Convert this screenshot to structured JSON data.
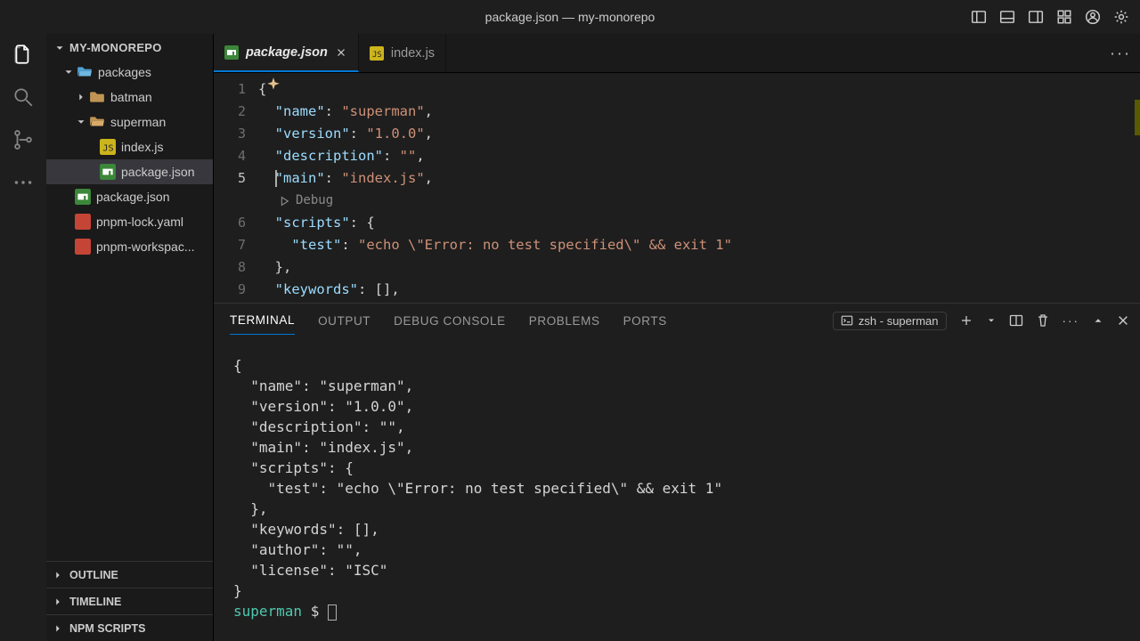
{
  "window": {
    "title": "package.json — my-monorepo"
  },
  "sidebar": {
    "header": "MY-MONOREPO",
    "tree": {
      "packages": "packages",
      "batman": "batman",
      "superman": "superman",
      "indexjs": "index.js",
      "packagejson": "package.json",
      "rootpkg": "package.json",
      "pnpmlock": "pnpm-lock.yaml",
      "pnpmws": "pnpm-workspac..."
    },
    "outline": "OUTLINE",
    "timeline": "TIMELINE",
    "npmscripts": "NPM SCRIPTS"
  },
  "tabs": {
    "active": "package.json",
    "second": "index.js"
  },
  "editor": {
    "lines": [
      "1",
      "2",
      "3",
      "4",
      "5",
      "6",
      "7",
      "8",
      "9"
    ],
    "brace_open": "{",
    "name_key": "\"name\"",
    "name_val": "\"superman\"",
    "version_key": "\"version\"",
    "version_val": "\"1.0.0\"",
    "desc_key": "\"description\"",
    "desc_val": "\"\"",
    "main_key": "\"main\"",
    "main_val": "\"index.js\"",
    "scripts_key": "\"scripts\"",
    "test_key": "\"test\"",
    "test_val": "\"echo \\\"Error: no test specified\\\" && exit 1\"",
    "brace_close": "},",
    "keywords_key": "\"keywords\"",
    "keywords_val": "[]",
    "debug_lens": "Debug"
  },
  "panel": {
    "tabs": {
      "terminal": "TERMINAL",
      "output": "OUTPUT",
      "debug": "DEBUG CONSOLE",
      "problems": "PROBLEMS",
      "ports": "PORTS"
    },
    "shell": "zsh - superman",
    "terminal_lines": [
      "{",
      "  \"name\": \"superman\",",
      "  \"version\": \"1.0.0\",",
      "  \"description\": \"\",",
      "  \"main\": \"index.js\",",
      "  \"scripts\": {",
      "    \"test\": \"echo \\\"Error: no test specified\\\" && exit 1\"",
      "  },",
      "  \"keywords\": [],",
      "  \"author\": \"\",",
      "  \"license\": \"ISC\"",
      "}"
    ],
    "prompt_dir": "superman",
    "prompt_sym": "$"
  }
}
